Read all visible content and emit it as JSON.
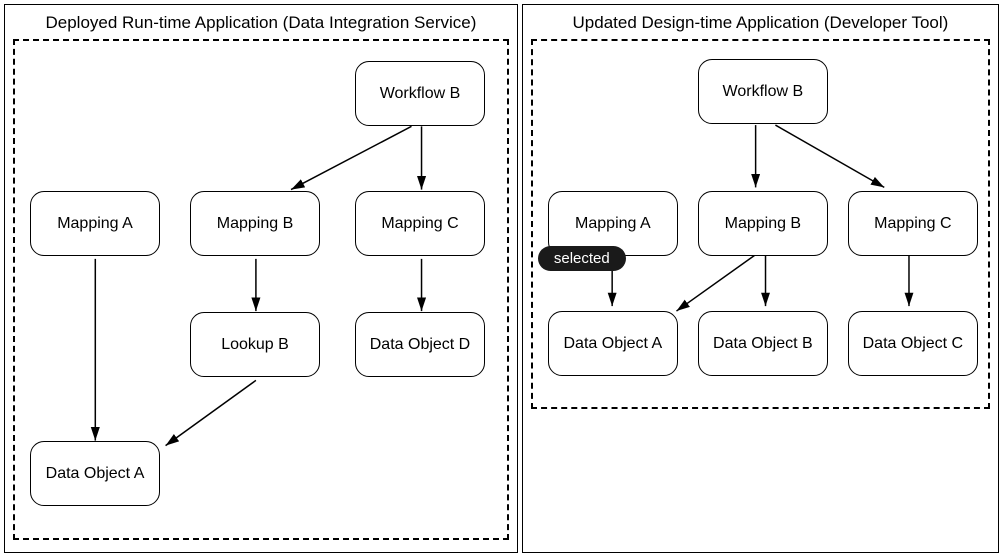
{
  "left": {
    "title": "Deployed Run-time Application (Data Integration Service)",
    "nodes": {
      "workflowB": "Workflow B",
      "mappingA": "Mapping A",
      "mappingB": "Mapping B",
      "mappingC": "Mapping C",
      "lookupB": "Lookup B",
      "dataObjectD": "Data Object D",
      "dataObjectA": "Data Object A"
    }
  },
  "right": {
    "title": "Updated Design-time Application (Developer Tool)",
    "nodes": {
      "workflowB": "Workflow B",
      "mappingA": "Mapping A",
      "mappingB": "Mapping B",
      "mappingC": "Mapping C",
      "dataObjectA": "Data Object A",
      "dataObjectB": "Data Object B",
      "dataObjectC": "Data Object C"
    },
    "badge": "selected"
  }
}
